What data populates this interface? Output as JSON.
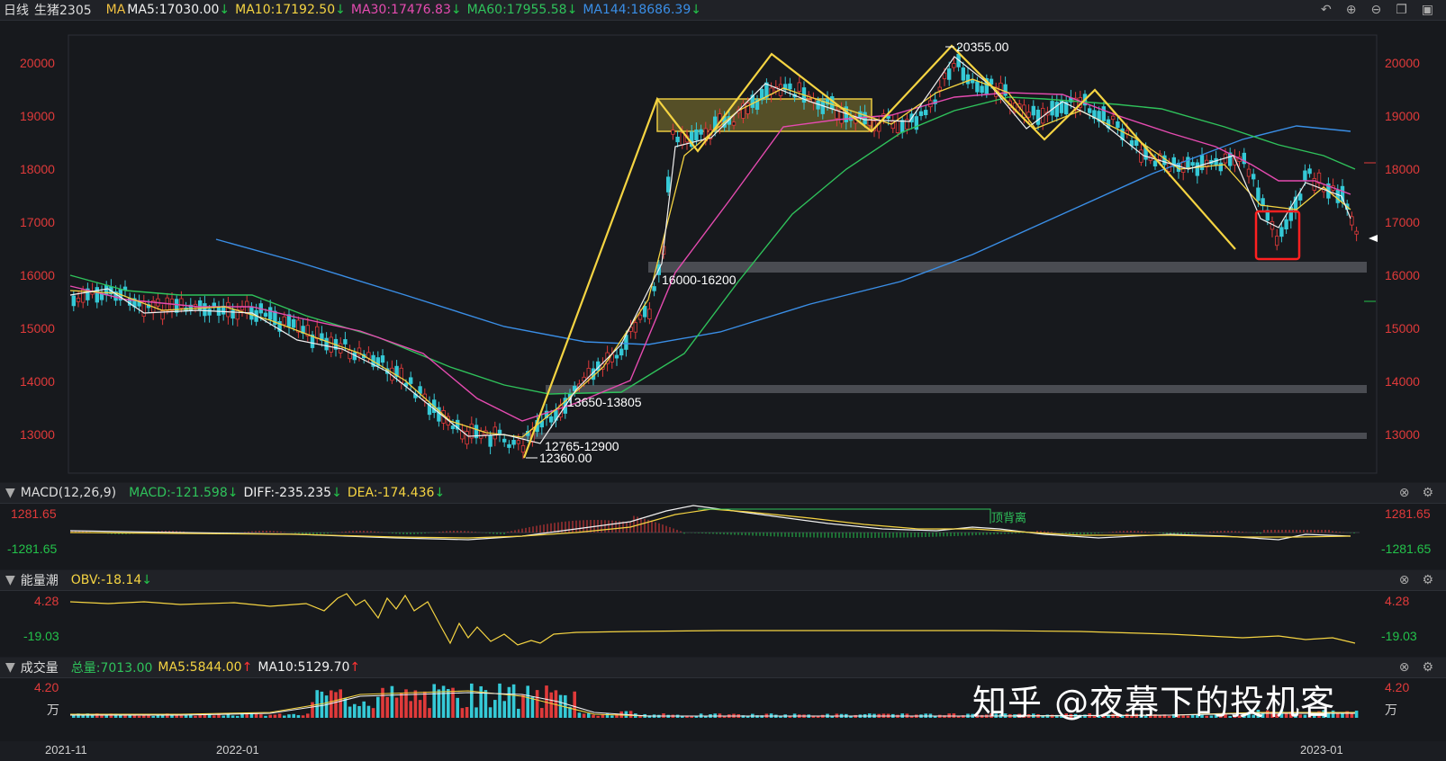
{
  "header": {
    "period": "日线",
    "symbol": "生猪2305",
    "ma_label": "MA",
    "ma5": "MA5:17030.00",
    "ma10": "MA10:17192.50",
    "ma30": "MA30:17476.83",
    "ma60": "MA60:17955.58",
    "ma144": "MA144:18686.39",
    "colors": {
      "ma5": "#f0f0f0",
      "ma10": "#f5d442",
      "ma30": "#e54bb0",
      "ma60": "#2fc25b",
      "ma144": "#3a8ee6"
    }
  },
  "main_axis": {
    "ticks": [
      "20000",
      "19000",
      "18000",
      "17000",
      "16000",
      "15000",
      "14000",
      "13000"
    ]
  },
  "annotations": {
    "high": "20355.00",
    "low": "12360.00",
    "zone1": "16000-16200",
    "zone2": "13650-13805",
    "zone3": "12765-12900"
  },
  "macd": {
    "title": "MACD(12,26,9)",
    "macd": "MACD:-121.598",
    "diff": "DIFF:-235.235",
    "dea": "DEA:-174.436",
    "top": "1281.65",
    "bottom": "-1281.65",
    "divergence_label": "顶背离"
  },
  "obv": {
    "title": "能量潮",
    "value": "OBV:-18.14",
    "top": "4.28",
    "bottom": "-19.03"
  },
  "volume": {
    "title": "成交量",
    "total": "总量:7013.00",
    "ma5": "MA5:5844.00",
    "ma10": "MA10:5129.70",
    "top": "4.20",
    "unit": "万"
  },
  "x_axis": {
    "labels": [
      "2021-11",
      "2022-01",
      "2023-01"
    ]
  },
  "watermark": "知乎 @夜幕下的投机客"
}
